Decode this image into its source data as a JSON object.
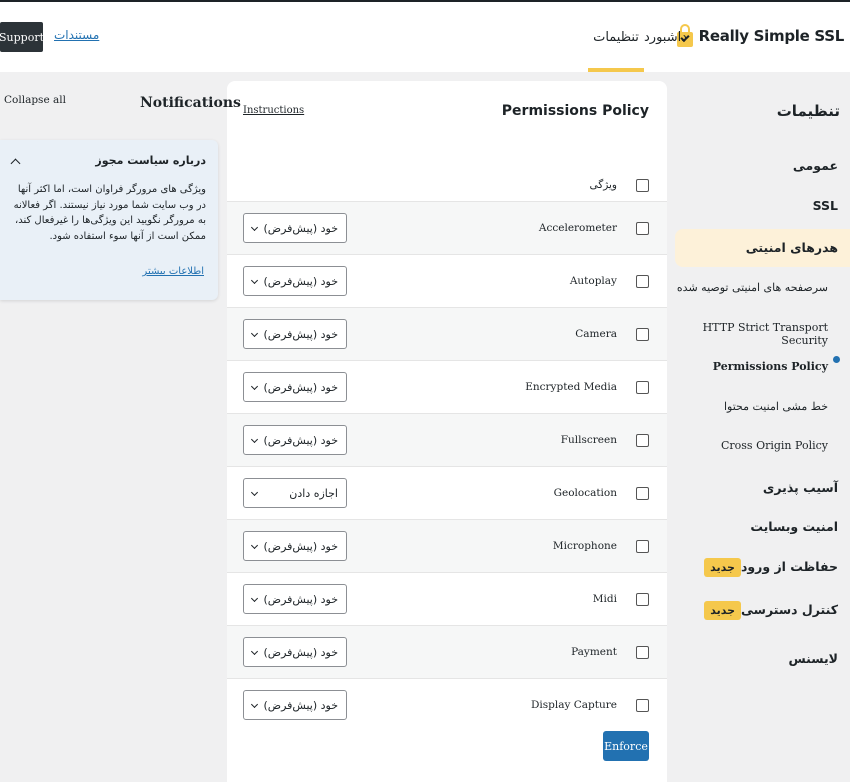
{
  "header": {
    "logo_text": "Really Simple SSL",
    "nav_dashboard": "داشبورد",
    "nav_settings": "تنظیمات",
    "docs_link": "مستندات",
    "support_button": "Support"
  },
  "sidebar": {
    "title": "تنظیمات",
    "items": [
      {
        "label": "عمومی"
      },
      {
        "label": "SSL"
      },
      {
        "label": "هدرهای امنیتی"
      },
      {
        "label": "آسیب پذیری"
      },
      {
        "label": "امنیت وبسایت"
      },
      {
        "label": "حفاظت از ورود",
        "badge": "جدید"
      },
      {
        "label": "کنترل دسترسی",
        "badge": "جدید"
      },
      {
        "label": "لایسنس"
      }
    ],
    "subitems": [
      {
        "label": "سرصفحه های امنیتی توصیه شده"
      },
      {
        "label": "HTTP Strict Transport Security"
      },
      {
        "label": "Permissions Policy"
      },
      {
        "label": "خط مشی امنیت محتوا"
      },
      {
        "label": "Cross Origin Policy"
      }
    ]
  },
  "panel": {
    "title": "Permissions Policy",
    "instructions": "Instructions",
    "header_feature": "ویژگی",
    "rows": [
      {
        "feature": "Accelerometer",
        "value": "خود (پیش‌فرض)"
      },
      {
        "feature": "Autoplay",
        "value": "خود (پیش‌فرض)"
      },
      {
        "feature": "Camera",
        "value": "خود (پیش‌فرض)"
      },
      {
        "feature": "Encrypted Media",
        "value": "خود (پیش‌فرض)"
      },
      {
        "feature": "Fullscreen",
        "value": "خود (پیش‌فرض)"
      },
      {
        "feature": "Geolocation",
        "value": "اجازه دادن"
      },
      {
        "feature": "Microphone",
        "value": "خود (پیش‌فرض)"
      },
      {
        "feature": "Midi",
        "value": "خود (پیش‌فرض)"
      },
      {
        "feature": "Payment",
        "value": "خود (پیش‌فرض)"
      },
      {
        "feature": "Display Capture",
        "value": "خود (پیش‌فرض)"
      }
    ],
    "enforce_button": "Enforce"
  },
  "notifications": {
    "title": "Notifications",
    "collapse_all": "Collapse all",
    "card_title": "درباره سیاست مجوز",
    "card_body": "ویژگی های مرورگر فراوان است، اما اکثر آنها در وب سایت شما مورد نیاز نیستند. اگر فعالانه به مرورگر نگویید این ویژگی‌ها را غیرفعال کند، ممکن است از آنها سوء استفاده شود.",
    "card_link": "اطلاعات بیشتر"
  }
}
